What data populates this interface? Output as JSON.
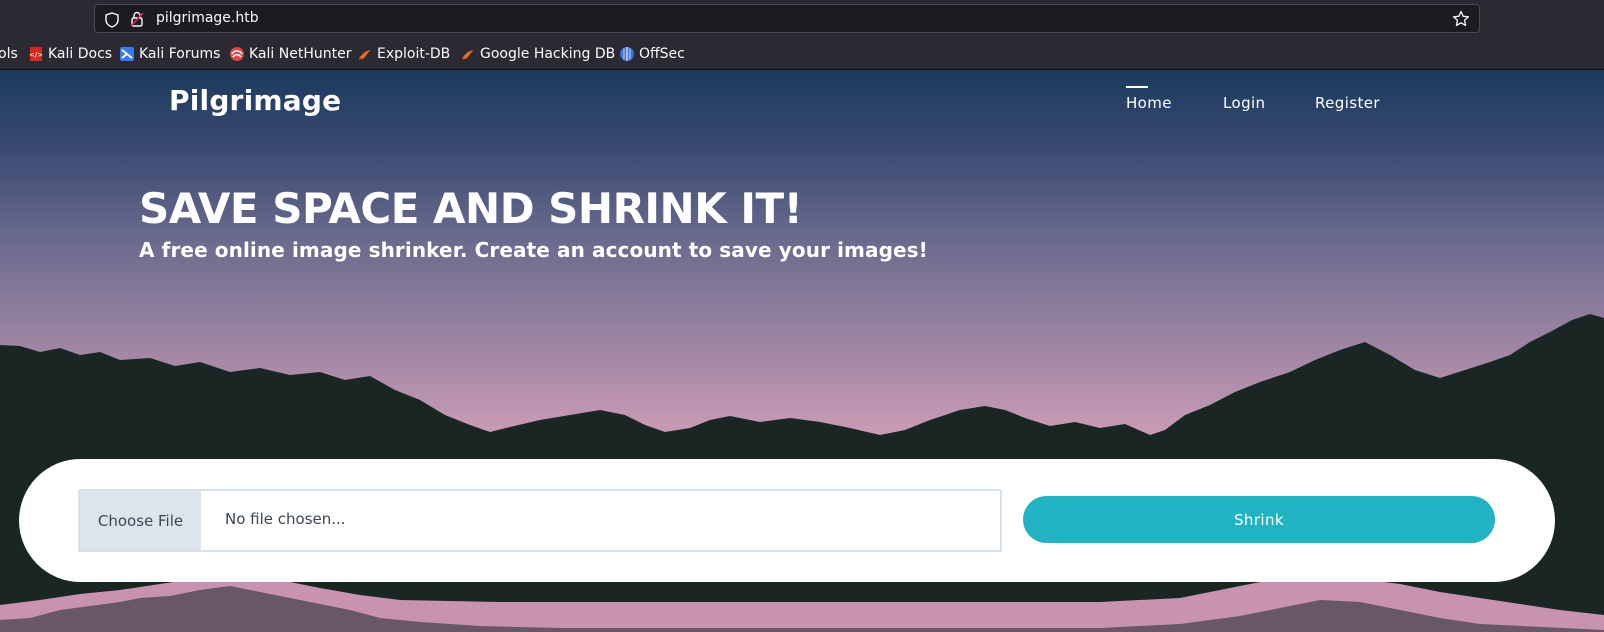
{
  "browser": {
    "url": "pilgrimage.htb",
    "bookmarks": [
      {
        "label": "ols",
        "icon": "kali-tools-icon"
      },
      {
        "label": "Kali Docs",
        "icon": "kali-docs-icon"
      },
      {
        "label": "Kali Forums",
        "icon": "kali-forums-icon"
      },
      {
        "label": "Kali NetHunter",
        "icon": "kali-nethunter-icon"
      },
      {
        "label": "Exploit-DB",
        "icon": "exploit-db-icon"
      },
      {
        "label": "Google Hacking DB",
        "icon": "google-hacking-db-icon"
      },
      {
        "label": "OffSec",
        "icon": "offsec-icon"
      }
    ]
  },
  "site": {
    "brand": "Pilgrimage",
    "nav": [
      {
        "label": "Home",
        "active": true
      },
      {
        "label": "Login",
        "active": false
      },
      {
        "label": "Register",
        "active": false
      }
    ]
  },
  "hero": {
    "title": "SAVE SPACE AND SHRINK IT!",
    "subtitle": "A free online image shrinker. Create an account to save your images!"
  },
  "upload": {
    "choose_label": "Choose File",
    "file_name": "No file chosen...",
    "submit_label": "Shrink"
  },
  "colors": {
    "accent": "#22b3c3",
    "mountains": "#1a2624",
    "sky_top": "#1b3a5e",
    "sky_bottom": "#e2a6bf"
  }
}
